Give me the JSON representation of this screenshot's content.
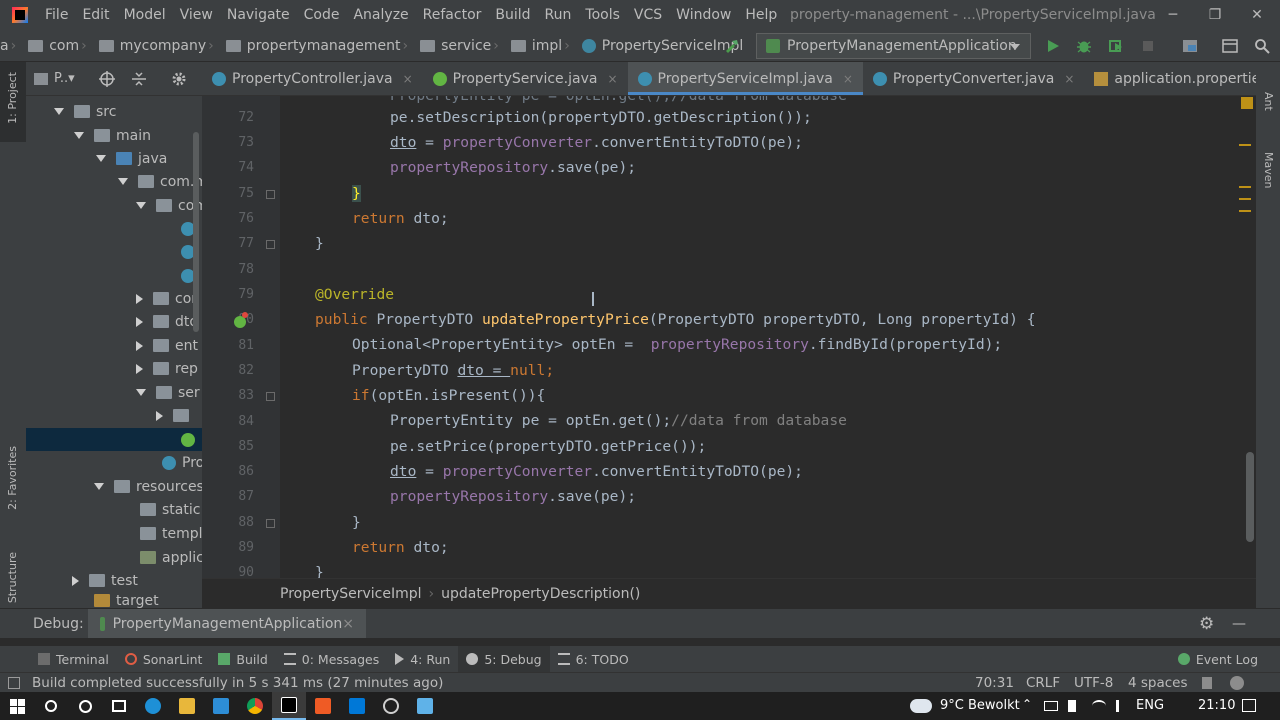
{
  "menu": [
    "File",
    "Edit",
    "Model",
    "View",
    "Navigate",
    "Code",
    "Analyze",
    "Refactor",
    "Build",
    "Run",
    "Tools",
    "VCS",
    "Window",
    "Help"
  ],
  "window_title": "property-management - ...\\PropertyServiceImpl.java",
  "window_controls": {
    "minimize": "─",
    "maximize": "❐",
    "close": "✕"
  },
  "breadcrumbs": {
    "items": [
      "a",
      "com",
      "mycompany",
      "propertymanagement",
      "service",
      "impl",
      "PropertyServiceImpl"
    ],
    "separator": "›"
  },
  "run_config": "PropertyManagementApplication",
  "project_panel": {
    "title": "P..▾",
    "tree": [
      "src",
      "main",
      "java",
      "com.m",
      "com",
      "con",
      "dto",
      "ent",
      "rep",
      "ser",
      "Pro",
      "resources",
      "static",
      "templa",
      "applica",
      "test",
      "target"
    ]
  },
  "left_stripe": {
    "project": "1: Project",
    "favorites": "2: Favorites",
    "structure": "Z: Structure"
  },
  "right_stripe": {
    "ant": "Ant",
    "maven": "Maven"
  },
  "tabs": [
    {
      "label": "PropertyController.java"
    },
    {
      "label": "PropertyService.java"
    },
    {
      "label": "PropertyServiceImpl.java"
    },
    {
      "label": "PropertyConverter.java"
    },
    {
      "label": "application.properties"
    }
  ],
  "tab_close": "×",
  "line_numbers": [
    "72",
    "73",
    "74",
    "75",
    "76",
    "77",
    "78",
    "79",
    "80",
    "81",
    "82",
    "83",
    "84",
    "85",
    "86",
    "87",
    "88",
    "89",
    "90"
  ],
  "code": {
    "l71": "PropertyEntity pe = optEn.get();//data from database",
    "l72": "pe.setDescription(propertyDTO.getDescription());",
    "l73a": "dto",
    "l73b": " = ",
    "l73c": "propertyConverter",
    "l73d": ".convertEntityToDTO(pe);",
    "l74a": "propertyRepository",
    "l74b": ".save(pe);",
    "l75": "}",
    "l76a": "return ",
    "l76b": "dto;",
    "l77": "}",
    "l79": "@Override",
    "l80a": "public ",
    "l80b": "PropertyDTO ",
    "l80c": "updatePropertyPrice",
    "l80d": "(PropertyDTO propertyDTO, Long propertyId) {",
    "l81a": "Optional<PropertyEntity> optEn =  ",
    "l81b": "propertyRepository",
    "l81c": ".findById(propertyId);",
    "l82a": "PropertyDTO ",
    "l82b": "dto = ",
    "l82c": "null",
    "l82d": ";",
    "l83a": "if",
    "l83b": "(optEn.isPresent()){",
    "l84a": "PropertyEntity pe = optEn.get();",
    "l84b": "//data from database",
    "l85": "pe.setPrice(propertyDTO.getPrice());",
    "l86a": "dto",
    "l86b": " = ",
    "l86c": "propertyConverter",
    "l86d": ".convertEntityToDTO(pe);",
    "l87a": "propertyRepository",
    "l87b": ".save(pe);",
    "l88": "}",
    "l89a": "return ",
    "l89b": "dto;",
    "l90": "}"
  },
  "editor_breadcrumbs": [
    "PropertyServiceImpl",
    "updatePropertyDescription()"
  ],
  "debug": {
    "label": "Debug:",
    "session": "PropertyManagementApplication",
    "session_close": "×",
    "settings_icon": "⚙",
    "hide_icon": "—"
  },
  "tool_windows": [
    {
      "label": "Terminal"
    },
    {
      "label": "SonarLint"
    },
    {
      "label": "Build"
    },
    {
      "label": "0: Messages"
    },
    {
      "label": "4: Run"
    },
    {
      "label": "5: Debug"
    },
    {
      "label": "6: TODO"
    }
  ],
  "event_log": "Event Log",
  "status": {
    "message": "Build completed successfully in 5 s 341 ms (27 minutes ago)",
    "position": "70:31",
    "line_sep": "CRLF",
    "encoding": "UTF-8",
    "indent": "4 spaces"
  },
  "taskbar": {
    "weather": "9°C  Bewolkt",
    "lang": "ENG",
    "time": "21:10"
  },
  "colors": {
    "keyword": "#cc7832",
    "annotation": "#bbb529",
    "method": "#ffc66d",
    "field": "#9876aa",
    "comment": "#808080",
    "accent": "#4a88c7"
  }
}
